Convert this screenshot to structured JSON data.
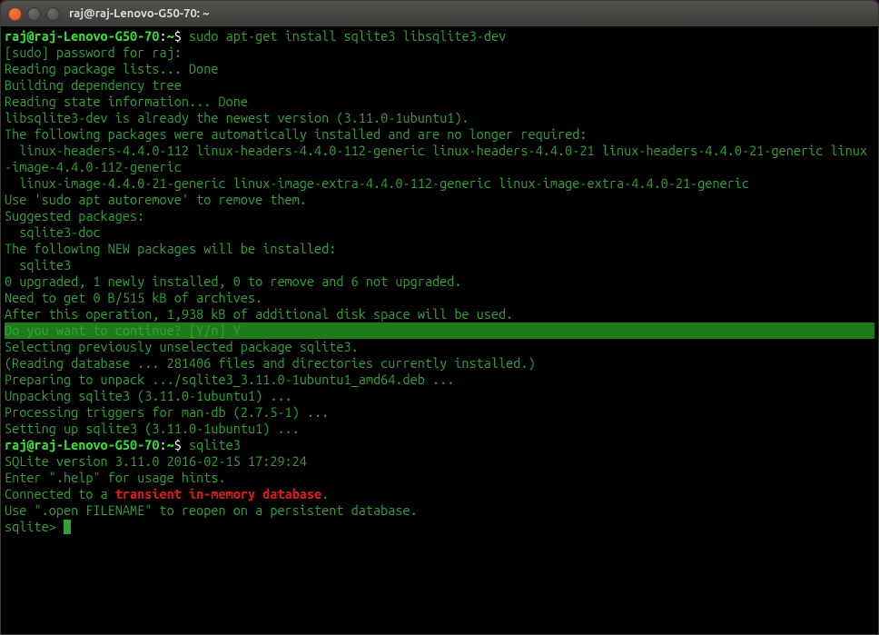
{
  "window": {
    "title": "raj@raj-Lenovo-G50-70: ~"
  },
  "prompt": {
    "user_host": "raj@raj-Lenovo-G50-70",
    "sep": ":",
    "path": "~",
    "dollar": "$"
  },
  "commands": {
    "cmd1": " sudo apt-get install sqlite3 libsqlite3-dev",
    "cmd2": " sqlite3"
  },
  "lines": {
    "l1": "[sudo] password for raj: ",
    "l2": "Reading package lists... Done",
    "l3": "Building dependency tree       ",
    "l4": "Reading state information... Done",
    "l5": "libsqlite3-dev is already the newest version (3.11.0-1ubuntu1).",
    "l6": "The following packages were automatically installed and are no longer required:",
    "l7": "  linux-headers-4.4.0-112 linux-headers-4.4.0-112-generic linux-headers-4.4.0-21 linux-headers-4.4.0-21-generic linux-image-4.4.0-112-generic",
    "l8": "  linux-image-4.4.0-21-generic linux-image-extra-4.4.0-112-generic linux-image-extra-4.4.0-21-generic",
    "l9": "Use 'sudo apt autoremove' to remove them.",
    "l10": "Suggested packages:",
    "l11": "  sqlite3-doc",
    "l12": "The following NEW packages will be installed:",
    "l13": "  sqlite3",
    "l14": "0 upgraded, 1 newly installed, 0 to remove and 6 not upgraded.",
    "l15": "Need to get 0 B/515 kB of archives.",
    "l16": "After this operation, 1,938 kB of additional disk space will be used.",
    "l17": "Do you want to continue? [Y/n] Y",
    "l18": "Selecting previously unselected package sqlite3.",
    "l19": "(Reading database ... 281406 files and directories currently installed.)",
    "l20": "Preparing to unpack .../sqlite3_3.11.0-1ubuntu1_amd64.deb ...",
    "l21": "Unpacking sqlite3 (3.11.0-1ubuntu1) ...",
    "l22": "Processing triggers for man-db (2.7.5-1) ...",
    "l23": "Setting up sqlite3 (3.11.0-1ubuntu1) ...",
    "l24": "SQLite version 3.11.0 2016-02-15 17:29:24",
    "l25": "Enter \".help\" for usage hints.",
    "l26a": "Connected to a ",
    "l26b": "transient in-memory database",
    "l26c": ".",
    "l27": "Use \".open FILENAME\" to reopen on a persistent database.",
    "l28": "sqlite> "
  }
}
